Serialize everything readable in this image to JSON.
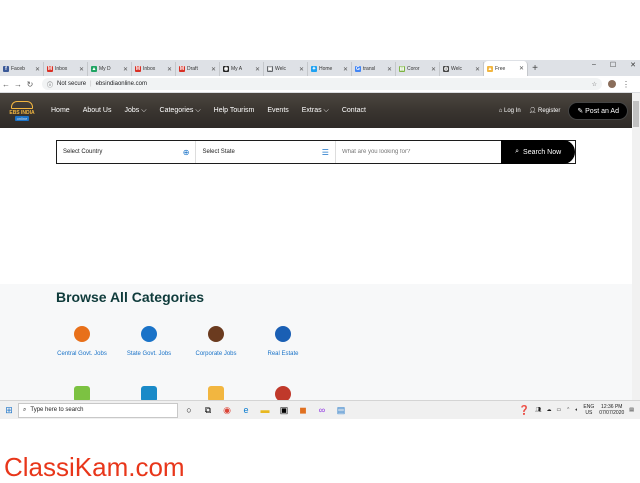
{
  "browser": {
    "tabs": [
      {
        "label": "Faceb",
        "color": "#3b5998",
        "glyph": "f"
      },
      {
        "label": "Inbox",
        "color": "#d93025",
        "glyph": "M"
      },
      {
        "label": "My D",
        "color": "#1fa463",
        "glyph": "▲"
      },
      {
        "label": "Inbox",
        "color": "#d93025",
        "glyph": "M"
      },
      {
        "label": "Draft",
        "color": "#d93025",
        "glyph": "M"
      },
      {
        "label": "My A",
        "color": "#222222",
        "glyph": "◉"
      },
      {
        "label": "Welc",
        "color": "#5f6368",
        "glyph": "▣"
      },
      {
        "label": "Home",
        "color": "#1da1f2",
        "glyph": "✦"
      },
      {
        "label": "transl",
        "color": "#4285f4",
        "glyph": "G"
      },
      {
        "label": "Coror",
        "color": "#7cb342",
        "glyph": "▤"
      },
      {
        "label": "Welc",
        "color": "#444444",
        "glyph": "◍"
      },
      {
        "label": "Free",
        "color": "#f2b640",
        "glyph": "▲"
      }
    ],
    "new_tab": "+",
    "window_controls": [
      "–",
      "☐",
      "✕"
    ],
    "security_label": "Not secure",
    "url": "ebsindiaonline.com"
  },
  "site": {
    "logo_name": "EBS INDIA",
    "logo_sub": "online",
    "nav": [
      "Home",
      "About Us",
      "Jobs ⌵",
      "Categories ⌵",
      "Help Tourism",
      "Events",
      "Extras ⌵",
      "Contact"
    ],
    "login": "Log In",
    "register": "Register",
    "post_ad": "Post an Ad"
  },
  "search": {
    "country": "Select Country",
    "state": "Select State",
    "keyword_placeholder": "What are you looking for?",
    "button": "Search Now"
  },
  "categories": {
    "title": "Browse All Categories",
    "items": [
      {
        "label": "Central Govt. Jobs",
        "color": "#e8701a"
      },
      {
        "label": "State Govt. Jobs",
        "color": "#1a73c8"
      },
      {
        "label": "Corporate Jobs",
        "color": "#6b3b1f"
      },
      {
        "label": "Real Estate",
        "color": "#1a5fb4"
      }
    ],
    "partial_icons": [
      "#7cc242",
      "#1a8ac8",
      "#f2b640",
      "#c0392b"
    ]
  },
  "taskbar": {
    "search_placeholder": "Type here to search",
    "lang": "ENG",
    "region": "US",
    "time": "12:36 PM",
    "date": "07/07/2020"
  },
  "watermark": "ClassiKam.com"
}
